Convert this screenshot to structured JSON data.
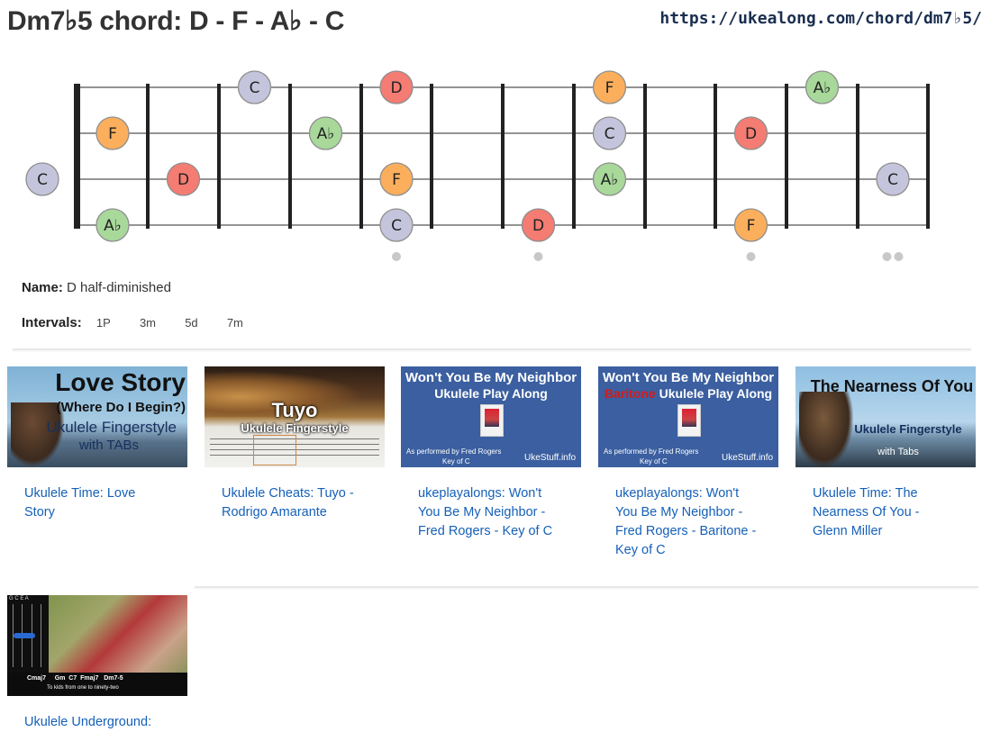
{
  "page": {
    "title": "Dm7♭5 chord: D - F - A♭ - C",
    "url": "https://ukealong.com/chord/dm7♭5/"
  },
  "fretboard": {
    "colors": {
      "D": "#f47c72",
      "F": "#fbae5c",
      "A♭": "#a8d89a",
      "C": "#c4c4dc"
    },
    "notes": [
      {
        "label": "C",
        "fret": 0,
        "string": 2
      },
      {
        "label": "F",
        "fret": 1,
        "string": 1
      },
      {
        "label": "A♭",
        "fret": 1,
        "string": 3
      },
      {
        "label": "D",
        "fret": 2,
        "string": 2
      },
      {
        "label": "C",
        "fret": 3,
        "string": 0
      },
      {
        "label": "A♭",
        "fret": 4,
        "string": 1
      },
      {
        "label": "D",
        "fret": 5,
        "string": 0
      },
      {
        "label": "F",
        "fret": 5,
        "string": 2
      },
      {
        "label": "C",
        "fret": 5,
        "string": 3
      },
      {
        "label": "D",
        "fret": 7,
        "string": 3
      },
      {
        "label": "F",
        "fret": 8,
        "string": 0
      },
      {
        "label": "C",
        "fret": 8,
        "string": 1
      },
      {
        "label": "A♭",
        "fret": 8,
        "string": 2
      },
      {
        "label": "D",
        "fret": 10,
        "string": 1
      },
      {
        "label": "F",
        "fret": 10,
        "string": 3
      },
      {
        "label": "A♭",
        "fret": 11,
        "string": 0
      },
      {
        "label": "C",
        "fret": 12,
        "string": 2
      }
    ],
    "markers": [
      {
        "fret": 5,
        "count": 1
      },
      {
        "fret": 7,
        "count": 1
      },
      {
        "fret": 10,
        "count": 1
      },
      {
        "fret": 12,
        "count": 2
      }
    ]
  },
  "info": {
    "name_label": "Name:",
    "name_value": "D half-diminished",
    "intervals_label": "Intervals:",
    "intervals": [
      "1P",
      "3m",
      "5d",
      "7m"
    ]
  },
  "videos": [
    {
      "title": "Ukulele Time: Love Story",
      "thumb_line1": "Love Story",
      "thumb_line2": "(Where Do I Begin?)",
      "thumb_line3": "Ukulele Fingerstyle",
      "thumb_line4": "with TABs"
    },
    {
      "title": "Ukulele Cheats: Tuyo - Rodrigo Amarante",
      "thumb_line1": "Tuyo",
      "thumb_line2": "Ukulele Fingerstyle"
    },
    {
      "title": "ukeplayalongs: Won't You Be My Neighbor - Fred Rogers - Key of C",
      "thumb_line1": "Won't You Be My Neighbor",
      "thumb_line2": "Ukulele Play Along",
      "thumb_line3": "As performed by Fred Rogers",
      "thumb_line4": "Key of C",
      "thumb_brand": "UkeStuff.info"
    },
    {
      "title": "ukeplayalongs: Won't You Be My Neighbor - Fred Rogers - Baritone - Key of C",
      "thumb_line1": "Won't You Be My Neighbor",
      "thumb_red": "Baritone",
      "thumb_line2": "Ukulele Play Along",
      "thumb_line3": "As performed by Fred Rogers",
      "thumb_line4": "Key of C",
      "thumb_brand": "UkeStuff.info"
    },
    {
      "title": "Ukulele Time: The Nearness Of You - Glenn Miller",
      "thumb_line1": "The Nearness Of You",
      "thumb_line2": "Ukulele Fingerstyle",
      "thumb_line3": "with Tabs"
    },
    {
      "title": "Ukulele Underground:",
      "thumb_chords": "Cmaj7     Gm  C7  Fmaj7   Dm7-5",
      "thumb_caption": "To kids from one to ninety-two",
      "thumb_strings": "G C E A"
    }
  ]
}
